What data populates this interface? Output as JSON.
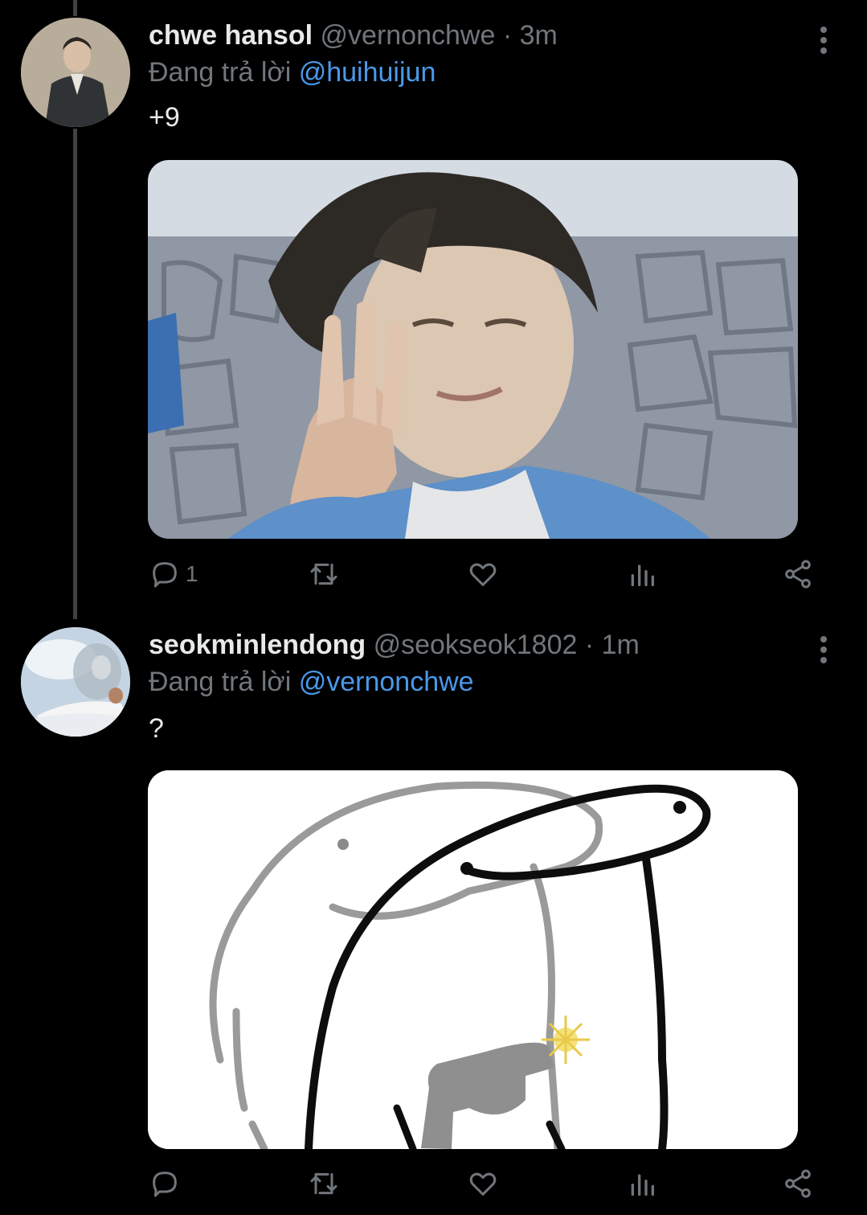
{
  "tweets": [
    {
      "display_name": "chwe hansol",
      "handle": "@vernonchwe",
      "separator": "·",
      "time": "3m",
      "reply_prefix": "Đang trả lời",
      "reply_to": "@huihuijun",
      "text": "+9",
      "reply_count": "1"
    },
    {
      "display_name": "seokminlendong",
      "handle": "@seokseok1802",
      "separator": "·",
      "time": "1m",
      "reply_prefix": "Đang trả lời",
      "reply_to": "@vernonchwe",
      "text": "?",
      "reply_count": ""
    }
  ],
  "icons": {
    "reply": "reply-icon",
    "retweet": "retweet-icon",
    "like": "heart-icon",
    "views": "views-icon",
    "share": "share-icon",
    "more": "more-vertical-icon"
  },
  "colors": {
    "background": "#000000",
    "text": "#e7e9ea",
    "muted": "#71767b",
    "mention": "#4a99e9",
    "thread_line": "#3e4144"
  }
}
